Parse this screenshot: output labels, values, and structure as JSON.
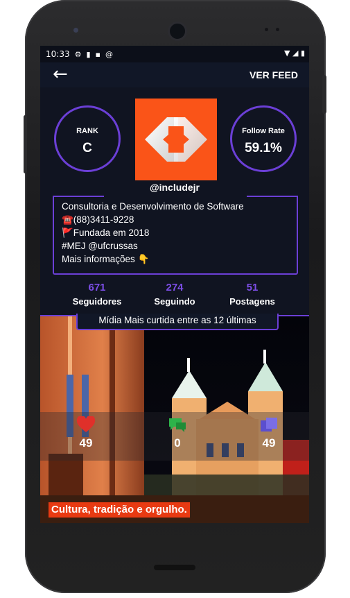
{
  "status": {
    "time": "10:33",
    "icons": [
      "gear-icon",
      "sim-icon",
      "sdcard-icon",
      "at-icon"
    ],
    "right_icons": [
      "wifi-icon",
      "signal-icon",
      "battery-icon"
    ]
  },
  "appbar": {
    "back_label": "←",
    "ver_feed": "VER FEED"
  },
  "rank": {
    "label": "RANK",
    "value": "C"
  },
  "follow_rate": {
    "label": "Follow Rate",
    "value": "59.1%"
  },
  "profile": {
    "handle": "@includejr",
    "logo_color": "#fa5418",
    "bio": [
      "Consultoria e Desenvolvimento de Software",
      "☎️(88)3411-9228",
      "🚩Fundada em 2018",
      "#MEJ @ufcrussas",
      "Mais informações 👇"
    ]
  },
  "stats": [
    {
      "num": "671",
      "label": "Seguidores"
    },
    {
      "num": "274",
      "label": "Seguindo"
    },
    {
      "num": "51",
      "label": "Postagens"
    }
  ],
  "banner": "Mídia Mais curtida entre as 12 últimas",
  "media": {
    "likes": "49",
    "comments": "0",
    "saves": "49",
    "caption": "Cultura, tradição e orgulho."
  },
  "colors": {
    "accent": "#6b3fd6",
    "stat_number": "#7c4ee6",
    "background": "#101421",
    "like_red": "#e0302a",
    "comment_green": "#2db34a",
    "save_purple": "#5b4fcf"
  }
}
